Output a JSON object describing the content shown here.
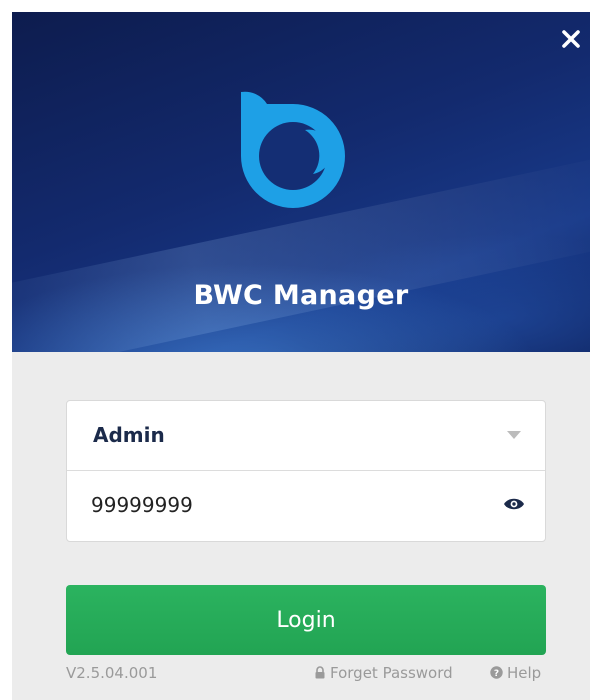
{
  "app": {
    "title": "BWC Manager",
    "brand_color": "#1ea0e6",
    "header_color": "#132a6e"
  },
  "window": {
    "close_icon": "close-icon"
  },
  "login_form": {
    "username": "Admin",
    "username_dropdown_icon": "chevron-down-icon",
    "password_value": "99999999",
    "password_toggle_icon": "eye-icon"
  },
  "login_button": {
    "label": "Login",
    "color": "#22a453"
  },
  "footer": {
    "version": "V2.5.04.001",
    "forgot_password": "Forget Password",
    "forgot_icon": "lock-icon",
    "help": "Help",
    "help_icon": "help-circle-icon"
  }
}
